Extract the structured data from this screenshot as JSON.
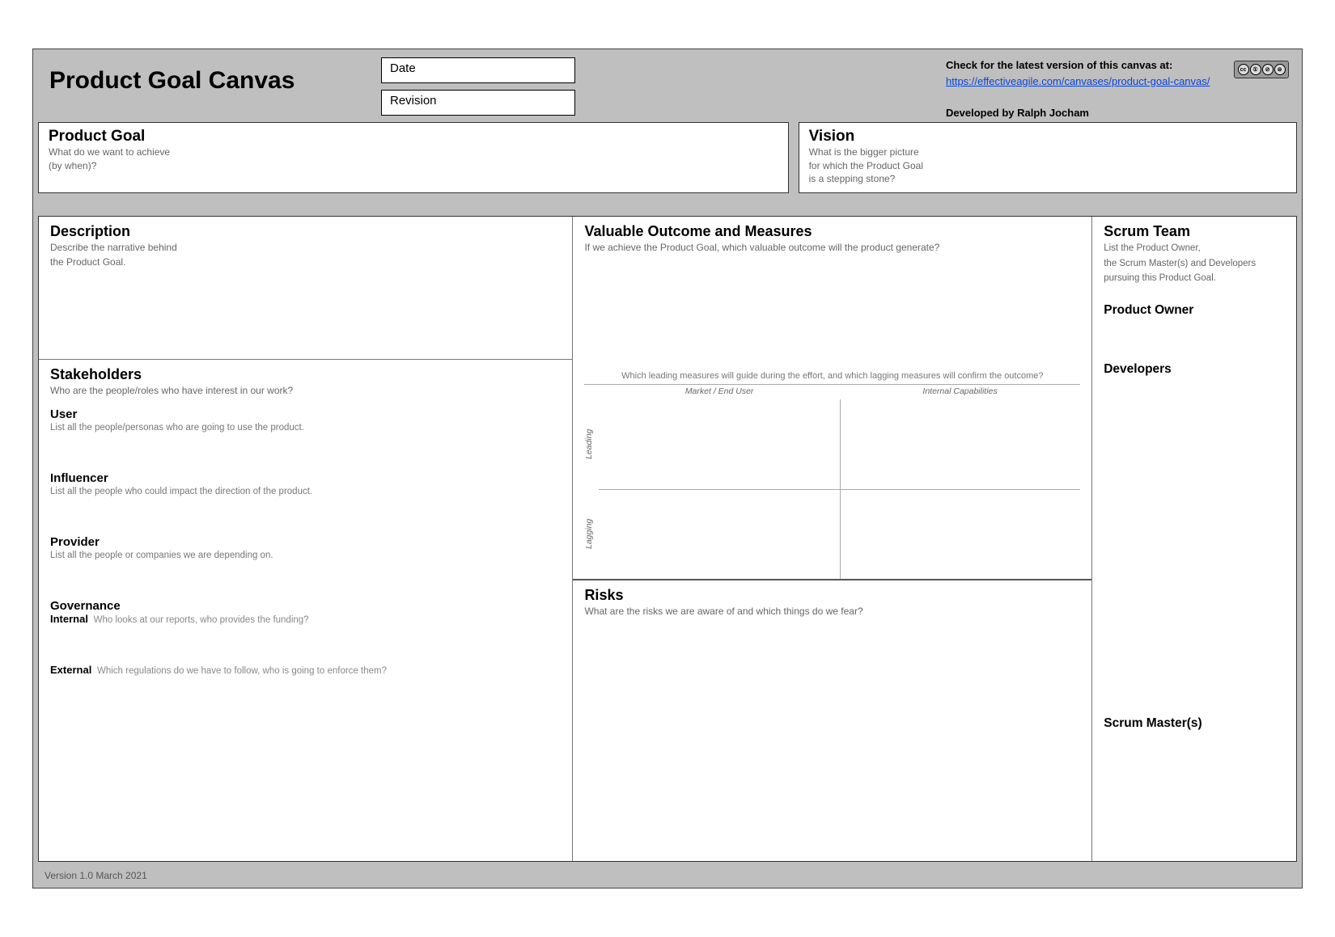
{
  "header": {
    "title": "Product Goal Canvas",
    "fields": {
      "date_label": "Date",
      "revision_label": "Revision"
    },
    "meta": {
      "check_line": "Check for the latest version of this canvas at:",
      "url_text": "https://effectiveagile.com/canvases/product-goal-canvas/",
      "developed_by": "Developed by Ralph Jocham"
    },
    "cc": {
      "b1": "cc",
      "b2": "①",
      "b3": "⊘",
      "b4": "⊜"
    }
  },
  "top": {
    "product_goal": {
      "title": "Product Goal",
      "sub1": "What do we want to achieve",
      "sub2": "(by when)?"
    },
    "vision": {
      "title": "Vision",
      "sub1": "What is the bigger picture",
      "sub2": "for which the Product Goal",
      "sub3": "is a stepping stone?"
    }
  },
  "left": {
    "description": {
      "title": "Description",
      "sub1": "Describe the narrative behind",
      "sub2": "the Product Goal."
    },
    "stakeholders": {
      "title": "Stakeholders",
      "sub": "Who are the people/roles who have interest in our work?",
      "user": {
        "label": "User",
        "desc": "List all the people/personas who are going to use the product."
      },
      "influencer": {
        "label": "Influencer",
        "desc": "List all the people who could impact the direction of the product."
      },
      "provider": {
        "label": "Provider",
        "desc": "List all the people or companies we are depending on."
      },
      "governance_label": "Governance",
      "gov_internal": {
        "label": "Internal",
        "hint": "Who looks at our reports, who provides the funding?"
      },
      "gov_external": {
        "label": "External",
        "hint": "Which regulations do we have to follow, who is going to enforce them?"
      }
    }
  },
  "mid": {
    "outcome": {
      "title": "Valuable Outcome and Measures",
      "sub": "If we achieve the Product Goal, which valuable outcome will the product generate?",
      "divider": "Which leading measures will guide during the effort, and which lagging measures will confirm the outcome?",
      "col1": "Market / End User",
      "col2": "Internal Capabilities",
      "row1": "Leading",
      "row2": "Lagging"
    },
    "risks": {
      "title": "Risks",
      "sub": "What are the risks we are aware of and which things do we fear?"
    }
  },
  "right": {
    "title": "Scrum Team",
    "desc1": "List the Product Owner,",
    "desc2": "the Scrum Master(s) and Developers",
    "desc3": "pursuing this Product Goal.",
    "po": "Product Owner",
    "dev": "Developers",
    "sm": "Scrum Master(s)"
  },
  "footer": "Version 1.0  March 2021"
}
